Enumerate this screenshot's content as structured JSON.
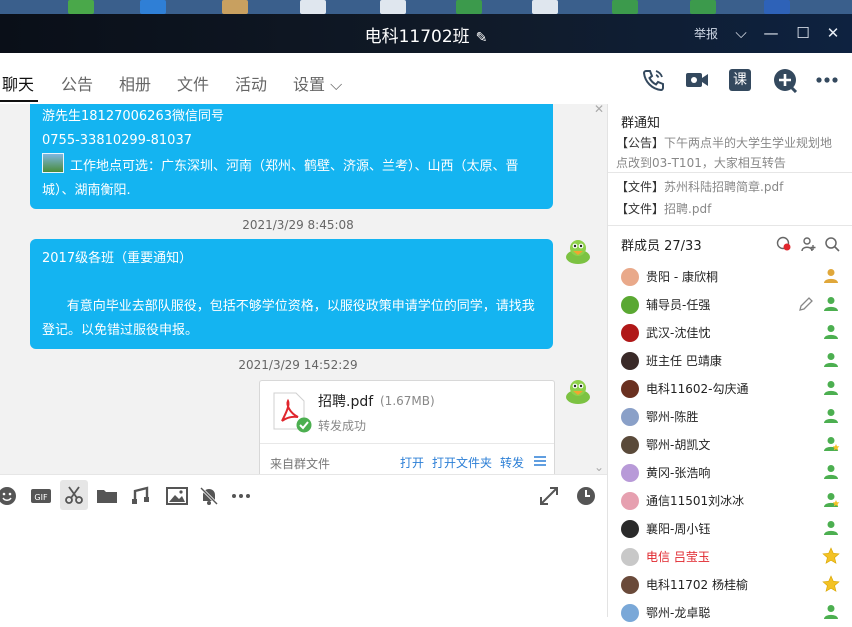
{
  "window": {
    "title": "电科11702班",
    "report_label": "举报"
  },
  "tabs": [
    {
      "label": "聊天",
      "active": true
    },
    {
      "label": "公告"
    },
    {
      "label": "相册"
    },
    {
      "label": "文件"
    },
    {
      "label": "活动"
    },
    {
      "label": "设置 ⌵"
    }
  ],
  "header_icons": [
    "phone-icon",
    "video-icon",
    "class-icon",
    "add-app-icon",
    "more-icon"
  ],
  "header_class_label": "课",
  "messages": [
    {
      "lines": [
        "游先生18127006263微信同号",
        "0755-33810299-81037",
        "工作地点可选：广东深圳、河南（郑州、鹤壁、济源、兰考）、山西（太原、晋",
        "城）、湖南衡阳."
      ]
    },
    {
      "timestamp": "2021/3/29 8:45:08",
      "lines": [
        "2017级各班（重要通知）",
        "",
        "      有意向毕业去部队服役，包括不够学位资格，以服役政策申请学位的同学，请找我",
        "登记。以免错过服役申报。"
      ]
    },
    {
      "timestamp": "2021/3/29 14:52:29",
      "file": {
        "name": "招聘.pdf",
        "size": "(1.67MB)",
        "status": "转发成功",
        "source": "来自群文件",
        "actions": [
          "打开",
          "打开文件夹",
          "转发"
        ]
      }
    }
  ],
  "sidebar": {
    "notice_title": "群通知",
    "notices": [
      {
        "tag": "【公告】",
        "text": "下午两点半的大学生学业规划地"
      },
      {
        "tag": "",
        "text": "点改到03-T101，大家相互转告"
      },
      {
        "tag": "【文件】",
        "text": "苏州科陆招聘简章.pdf"
      },
      {
        "tag": "【文件】",
        "text": "招聘.pdf"
      }
    ],
    "members_title": "群成员 27/33",
    "members": [
      {
        "name": "贵阳 - 康欣桐",
        "avatar_color": "#e9a98a",
        "badge": "person",
        "badge_color": "#e0a73a"
      },
      {
        "name": "辅导员-任强",
        "avatar_color": "#5aa832",
        "badge": "person",
        "badge_color": "#4caf50",
        "editable": true
      },
      {
        "name": "武汉-沈佳忱",
        "avatar_color": "#b01818",
        "badge": "person",
        "badge_color": "#4caf50"
      },
      {
        "name": "班主任 巴靖康",
        "avatar_color": "#3a2a28",
        "badge": "person",
        "badge_color": "#4caf50"
      },
      {
        "name": "电科11602-勾庆通",
        "avatar_color": "#6a3020",
        "badge": "person",
        "badge_color": "#4caf50"
      },
      {
        "name": "鄂州-陈胜",
        "avatar_color": "#8aa0c8",
        "badge": "person",
        "badge_color": "#4caf50"
      },
      {
        "name": "鄂州-胡凯文",
        "avatar_color": "#5a4a3a",
        "badge": "person-star",
        "badge_color": "#4caf50"
      },
      {
        "name": "黄冈-张浩响",
        "avatar_color": "#b89ad8",
        "badge": "person",
        "badge_color": "#4caf50"
      },
      {
        "name": "通信11501刘冰冰",
        "avatar_color": "#e6a0b0",
        "badge": "person-star",
        "badge_color": "#4caf50"
      },
      {
        "name": "襄阳-周小钰",
        "avatar_color": "#2a2a2a",
        "badge": "person",
        "badge_color": "#4caf50"
      },
      {
        "name": "电信 吕莹玉",
        "avatar_color": "#c8c8c8",
        "badge": "star",
        "badge_color": "#f3c225",
        "highlight": true
      },
      {
        "name": "电科11702 杨桂榆",
        "avatar_color": "#6a4a3a",
        "badge": "star",
        "badge_color": "#f3c225"
      },
      {
        "name": "鄂州-龙卓聪",
        "avatar_color": "#7aa8d8",
        "badge": "person",
        "badge_color": "#4caf50"
      }
    ]
  },
  "colors": {
    "bubble": "#14b4f1",
    "link": "#2c7fd6",
    "highlight_name": "#e0262d"
  }
}
